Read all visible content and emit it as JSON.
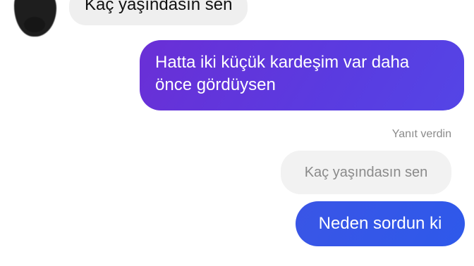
{
  "messages": {
    "incoming_top": "Kaç yaşındasın sen",
    "outgoing_long": "Hatta iki küçük kardeşim var daha önce gördüysen",
    "reply_label": "Yanıt verdin",
    "reply_quote": "Kaç yaşındasın sen",
    "outgoing_reply": "Neden sordun ki"
  },
  "colors": {
    "incoming_bubble": "#efefef",
    "outgoing_gradient_start": "#6a2fd6",
    "outgoing_gradient_end": "#5445e6",
    "reply_bubble": "#2e59ea",
    "muted_text": "#8a8a8a"
  }
}
